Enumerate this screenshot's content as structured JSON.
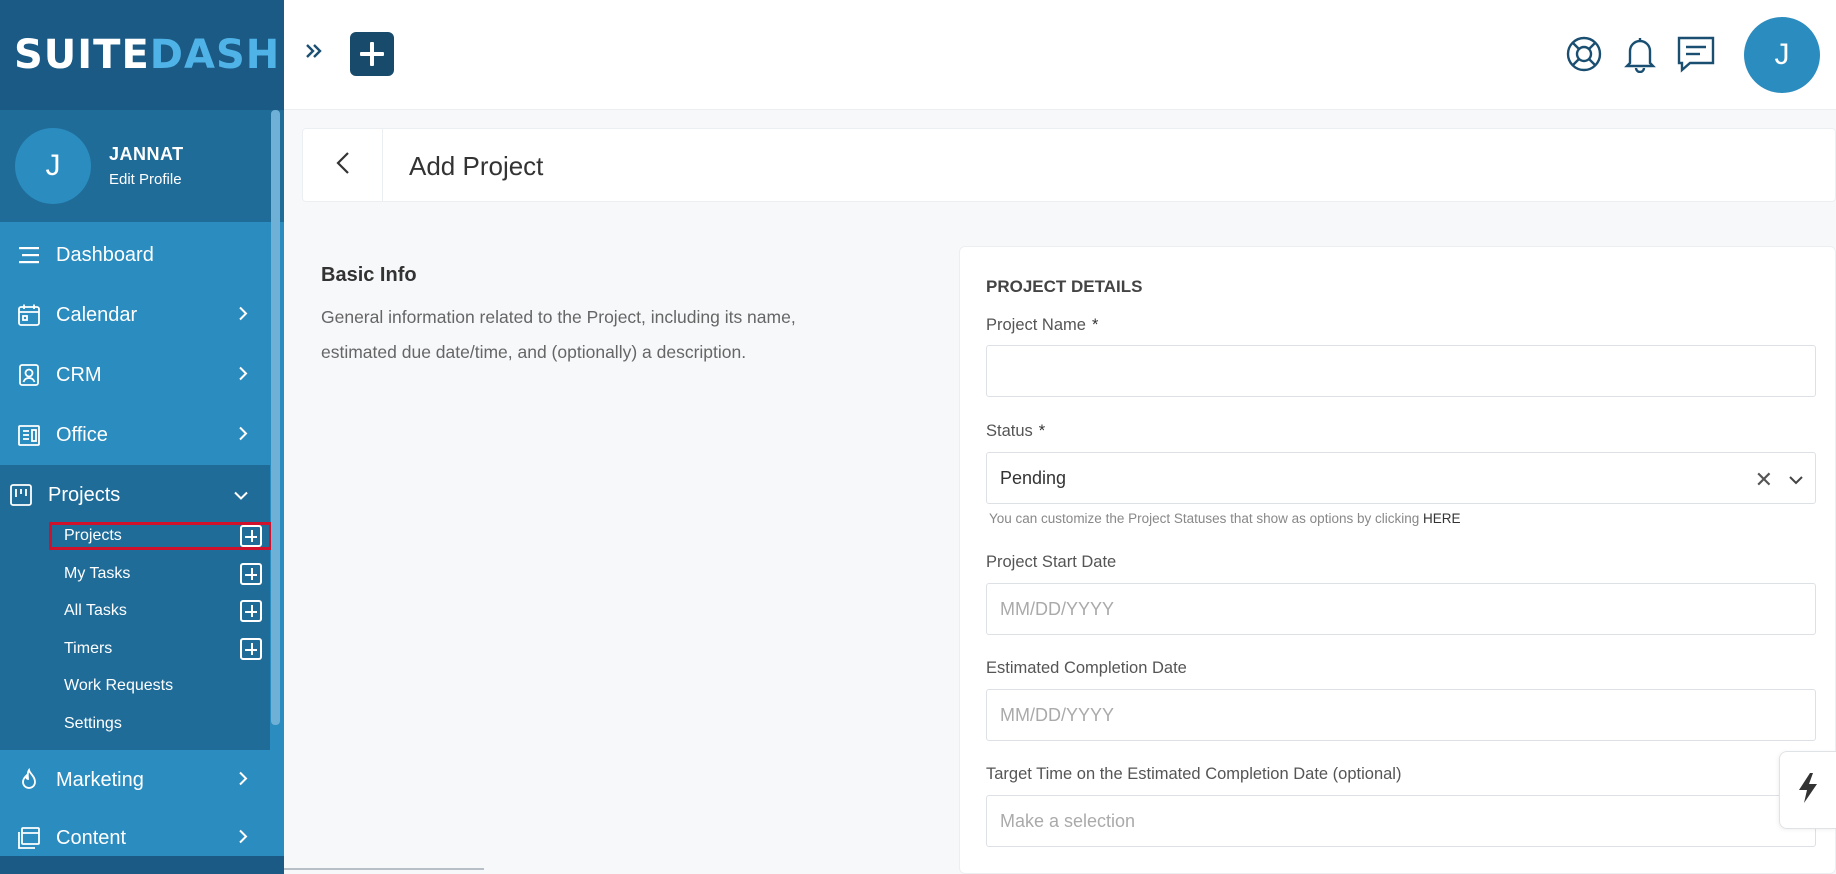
{
  "brand": {
    "logo_part1": "SUITE",
    "logo_part2": "DASH"
  },
  "user": {
    "initial": "J",
    "name": "JANNAT",
    "edit_label": "Edit Profile"
  },
  "sidebar": {
    "items": [
      {
        "label": "Dashboard",
        "icon": "menu-lines-icon"
      },
      {
        "label": "Calendar",
        "icon": "calendar-icon"
      },
      {
        "label": "CRM",
        "icon": "contact-card-icon"
      },
      {
        "label": "Office",
        "icon": "office-icon"
      },
      {
        "label": "Projects",
        "icon": "kanban-icon"
      },
      {
        "label": "Marketing",
        "icon": "flame-icon"
      },
      {
        "label": "Content",
        "icon": "content-icon"
      }
    ],
    "projects_sub": [
      {
        "label": "Projects",
        "has_add": true
      },
      {
        "label": "My Tasks",
        "has_add": true
      },
      {
        "label": "All Tasks",
        "has_add": true
      },
      {
        "label": "Timers",
        "has_add": true
      },
      {
        "label": "Work Requests",
        "has_add": false
      },
      {
        "label": "Settings",
        "has_add": false
      }
    ]
  },
  "topbar": {
    "initial": "J"
  },
  "page": {
    "title": "Add Project"
  },
  "info": {
    "title": "Basic Info",
    "description": "General information related to the Project, including its name, estimated due date/time, and (optionally) a description."
  },
  "form": {
    "section_title": "PROJECT DETAILS",
    "project_name_label": "Project Name",
    "required_mark": "*",
    "project_name_value": "",
    "status_label": "Status",
    "status_value": "Pending",
    "status_hint": "You can customize the Project Statuses that show as options by clicking",
    "status_hint_link": "HERE",
    "start_date_label": "Project Start Date",
    "start_date_placeholder": "MM/DD/YYYY",
    "completion_date_label": "Estimated Completion Date",
    "completion_date_placeholder": "MM/DD/YYYY",
    "target_time_label": "Target Time on the Estimated Completion Date (optional)",
    "target_time_placeholder": "Make a selection"
  },
  "colors": {
    "sidebar": "#2b8cbf",
    "sidebar_dark": "#1f6c99",
    "logo_bar": "#1a5a85",
    "highlight": "#d0112b"
  }
}
